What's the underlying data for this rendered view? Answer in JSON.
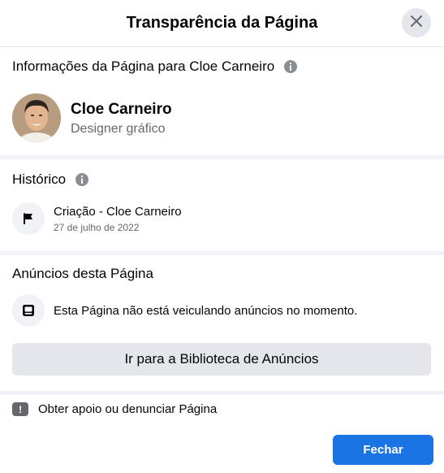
{
  "dialog": {
    "title": "Transparência da Página",
    "close_icon": "close-icon"
  },
  "page_info": {
    "heading": "Informações da Página para Cloe Carneiro",
    "info_icon": "info-icon",
    "name": "Cloe Carneiro",
    "category": "Designer gráfico"
  },
  "history": {
    "heading": "Histórico",
    "info_icon": "info-icon",
    "event": "Criação - Cloe Carneiro",
    "date": "27 de julho de 2022",
    "event_icon": "flag-icon"
  },
  "ads": {
    "heading": "Anúncios desta Página",
    "message": "Esta Página não está veiculando anúncios no momento.",
    "message_icon": "monitor-icon",
    "library_button": "Ir para a Biblioteca de Anúncios"
  },
  "report": {
    "label": "Obter apoio ou denunciar Página",
    "icon": "exclamation-icon"
  },
  "footer": {
    "close_button": "Fechar"
  },
  "colors": {
    "primary": "#1b74e4",
    "secondary_button": "#e4e6eb",
    "divider": "#f0f2f5",
    "secondary_text": "#65676b"
  }
}
